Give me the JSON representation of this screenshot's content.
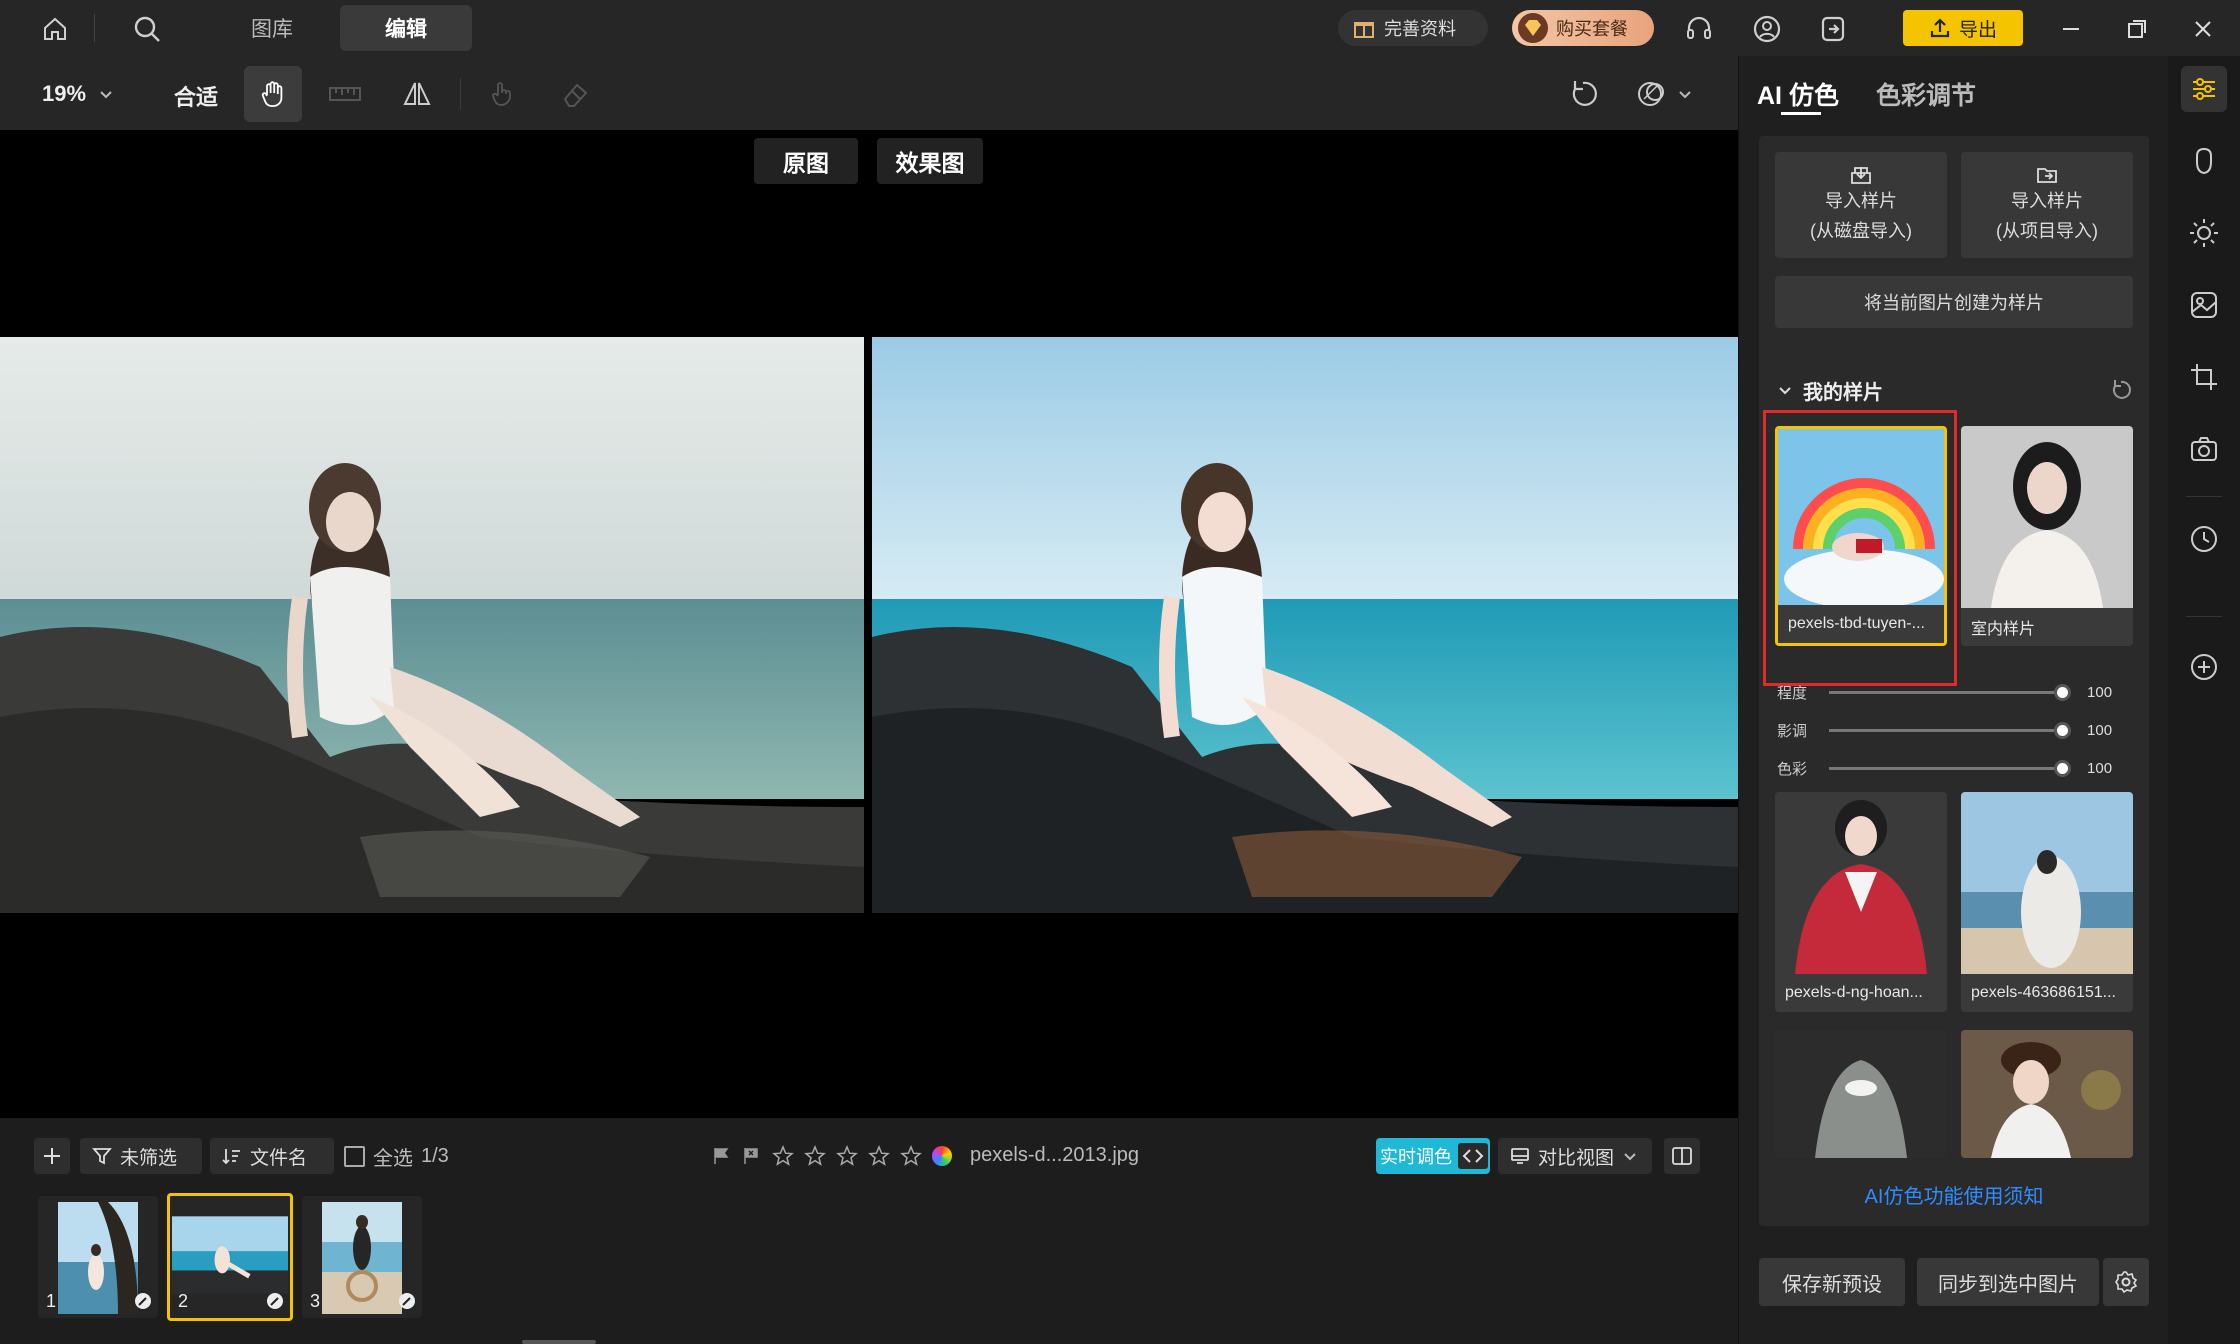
{
  "titlebar": {
    "tabs": [
      {
        "label": "图库",
        "active": false
      },
      {
        "label": "编辑",
        "active": true
      }
    ],
    "complete_profile": "完善资料",
    "buy_package": "购买套餐",
    "export": "导出"
  },
  "toolbar": {
    "zoom": "19%",
    "fit": "合适"
  },
  "canvas": {
    "original_label": "原图",
    "effect_label": "效果图"
  },
  "filmbar": {
    "filter": "未筛选",
    "sort": "文件名",
    "select_all": "全选",
    "count": "1/3",
    "filename": "pexels-d...2013.jpg",
    "realtime": "实时调色",
    "compare_view": "对比视图",
    "thumbs": [
      {
        "num": "1"
      },
      {
        "num": "2",
        "selected": true
      },
      {
        "num": "3"
      }
    ]
  },
  "panel": {
    "tab_ai": "AI 仿色",
    "tab_color": "色彩调节",
    "import_disk_l1": "导入样片",
    "import_disk_l2": "(从磁盘导入)",
    "import_project_l1": "导入样片",
    "import_project_l2": "(从项目导入)",
    "create_sample": "将当前图片创建为样片",
    "my_samples": "我的样片",
    "samples": [
      {
        "name": "pexels-tbd-tuyen-...",
        "selected": true
      },
      {
        "name": "室内样片"
      },
      {
        "name": "pexels-d-ng-hoan..."
      },
      {
        "name": "pexels-463686151..."
      },
      {
        "name": ""
      },
      {
        "name": ""
      }
    ],
    "sliders": [
      {
        "label": "程度",
        "value": "100"
      },
      {
        "label": "影调",
        "value": "100"
      },
      {
        "label": "色彩",
        "value": "100"
      }
    ],
    "help_link": "AI仿色功能使用须知",
    "save_preset": "保存新预设",
    "sync_selected": "同步到选中图片"
  },
  "colors": {
    "accent_yellow": "#f5c400",
    "highlight_red": "#e02b2b",
    "cyan": "#1fb8d6",
    "link_blue": "#2f8cff"
  }
}
